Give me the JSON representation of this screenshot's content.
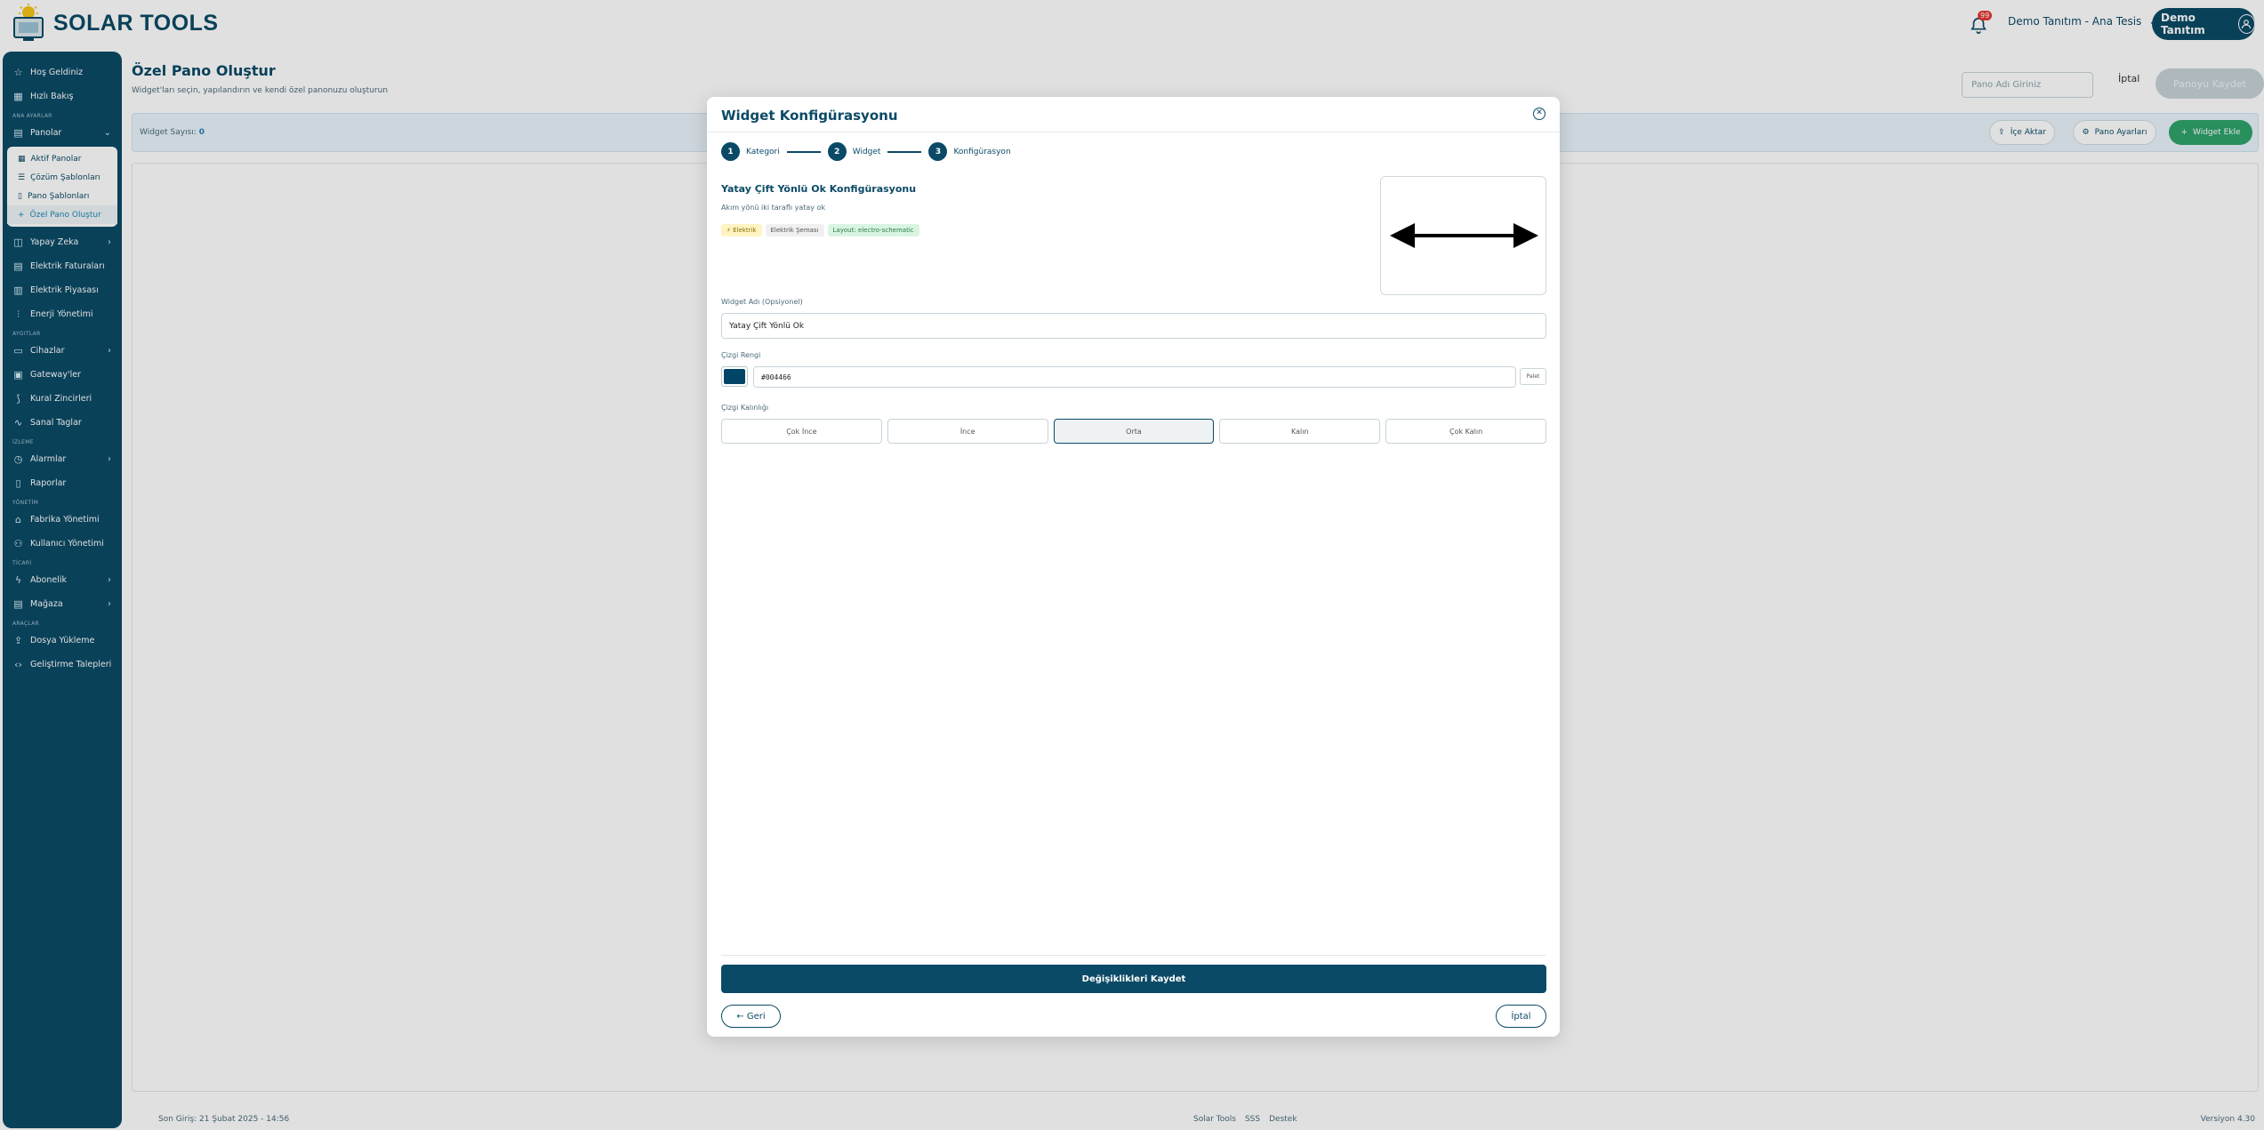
{
  "app": {
    "logo_text": "SOLAR TOOLS",
    "notification_count": "99",
    "tenant_label": "Demo Tanıtım - Ana Tesis",
    "user_name": "Demo Tanıtım"
  },
  "sidebar": {
    "top_items": [
      {
        "label": "Hoş Geldiniz",
        "icon": "star-icon"
      },
      {
        "label": "Hızlı Bakış",
        "icon": "grid-icon"
      }
    ],
    "section_main": "ANA AYARLAR",
    "panolar": {
      "label": "Panolar",
      "icon": "dashboard-icon"
    },
    "panolar_sub": [
      {
        "label": "Aktif Panolar"
      },
      {
        "label": "Çözüm Şablonları"
      },
      {
        "label": "Pano Şablonları"
      },
      {
        "label": "Özel Pano Oluştur"
      }
    ],
    "mid_items": [
      {
        "label": "Yapay Zeka",
        "icon": "chart-icon"
      },
      {
        "label": "Elektrik Faturaları",
        "icon": "invoice-icon"
      },
      {
        "label": "Elektrik Piyasası",
        "icon": "market-icon"
      },
      {
        "label": "Enerji Yönetimi",
        "icon": "sliders-icon"
      }
    ],
    "section_devices": "AYGITLAR",
    "device_items": [
      {
        "label": "Cihazlar",
        "icon": "monitor-icon"
      },
      {
        "label": "Gateway'ler",
        "icon": "gateway-icon"
      },
      {
        "label": "Kural Zincirleri",
        "icon": "chain-icon"
      },
      {
        "label": "Sanal Taglar",
        "icon": "wave-icon"
      }
    ],
    "section_monitor": "İZLEME",
    "monitor_items": [
      {
        "label": "Alarmlar",
        "icon": "alarm-icon"
      },
      {
        "label": "Raporlar",
        "icon": "report-icon"
      }
    ],
    "section_admin": "YÖNETİM",
    "admin_items": [
      {
        "label": "Fabrika Yönetimi",
        "icon": "factory-icon"
      },
      {
        "label": "Kullanıcı Yönetimi",
        "icon": "users-icon"
      }
    ],
    "section_billing": "TİCARİ",
    "billing_items": [
      {
        "label": "Abonelik",
        "icon": "bolt-icon"
      },
      {
        "label": "Mağaza",
        "icon": "store-icon"
      }
    ],
    "section_tools": "ARAÇLAR",
    "tool_items": [
      {
        "label": "Dosya Yükleme",
        "icon": "upload-icon"
      },
      {
        "label": "Geliştirme Talepleri",
        "icon": "code-icon"
      }
    ]
  },
  "page": {
    "title": "Özel Pano Oluştur",
    "subtitle": "Widget'ları seçin, yapılandırın ve kendi özel panonuzu oluşturun",
    "name_placeholder": "Pano Adı Giriniz",
    "cancel_label": "İptal",
    "save_label": "Panoyu Kaydet",
    "widget_count_label": "Widget Sayısı:",
    "widget_count": "0",
    "export_label": "İçe Aktar",
    "settings_label": "Pano Ayarları",
    "add_widget_label": "Widget Ekle"
  },
  "footer": {
    "last_login": "Son Giriş: 21 Şubat 2025 - 14:56",
    "links": [
      "Solar Tools",
      "SSS",
      "Destek"
    ],
    "version": "Versiyon 4.30"
  },
  "modal": {
    "title": "Widget Konfigürasyonu",
    "steps": [
      {
        "num": "1",
        "label": "Kategori"
      },
      {
        "num": "2",
        "label": "Widget"
      },
      {
        "num": "3",
        "label": "Konfigürasyon"
      }
    ],
    "config_title": "Yatay Çift Yönlü Ok Konfigürasyonu",
    "config_desc": "Akım yönü iki taraflı yatay ok",
    "tags": [
      "⚡ Elektrik",
      "Elektrik Şeması",
      "Layout: electro-schematic"
    ],
    "name_label": "Widget Adı (Opsiyonel)",
    "name_value": "Yatay Çift Yönlü Ok",
    "color_label": "Çizgi Rengi",
    "color_value": "#004466",
    "palette_label": "Palet",
    "thickness_label": "Çizgi Kalınlığı",
    "thickness_options": [
      "Çok İnce",
      "İnce",
      "Orta",
      "Kalın",
      "Çok Kalın"
    ],
    "thickness_selected": "Orta",
    "save_label": "Değişiklikleri Kaydet",
    "back_label": "← Geri",
    "cancel_label": "İptal"
  },
  "colors": {
    "brand": "#0b4a66",
    "accent_green": "#2ea36a",
    "line_color": "#004466"
  }
}
